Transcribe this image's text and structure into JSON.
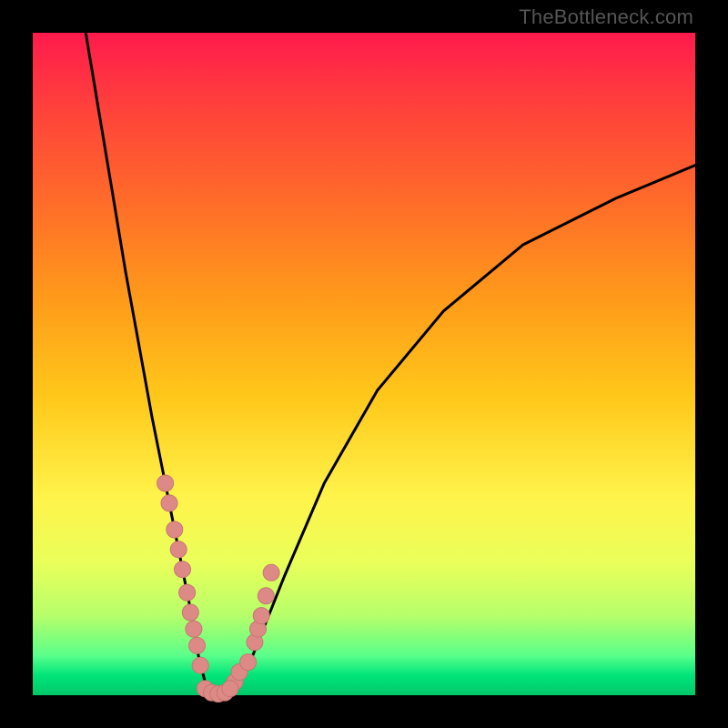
{
  "watermark": "TheBottleneck.com",
  "chart_data": {
    "type": "line",
    "title": "",
    "xlabel": "",
    "ylabel": "",
    "xlim": [
      0,
      100
    ],
    "ylim": [
      0,
      100
    ],
    "series": [
      {
        "name": "bottleneck-curve",
        "x": [
          8,
          10,
          12,
          14,
          16,
          18,
          20,
          21,
          22,
          23,
          24,
          24.5,
          25,
          25.5,
          26,
          27,
          28,
          29,
          30,
          32,
          34,
          38,
          44,
          52,
          62,
          74,
          88,
          100
        ],
        "values": [
          100,
          88,
          76,
          64,
          53,
          42,
          32,
          27,
          22,
          17,
          12,
          9,
          6,
          4,
          2,
          1,
          0,
          0,
          1,
          3,
          8,
          18,
          32,
          46,
          58,
          68,
          75,
          80
        ]
      }
    ],
    "markers_left": {
      "name": "cluster-left",
      "x": [
        20.0,
        20.6,
        21.4,
        22.0,
        22.6,
        23.3,
        23.8,
        24.3,
        24.8,
        25.3
      ],
      "values": [
        32,
        29,
        25,
        22,
        19,
        15.5,
        12.5,
        10,
        7.5,
        4.5
      ]
    },
    "markers_right": {
      "name": "cluster-right",
      "x": [
        30.5,
        31.2,
        32.5,
        33.5,
        34.0,
        34.5,
        35.2,
        36.0
      ],
      "values": [
        2,
        3.5,
        5,
        8,
        10,
        12,
        15,
        18.5
      ]
    },
    "markers_bottom": {
      "name": "cluster-bottom",
      "x": [
        26.0,
        27.0,
        28.0,
        29.0,
        29.8
      ],
      "values": [
        1.0,
        0.4,
        0.2,
        0.4,
        1.0
      ]
    },
    "colors": {
      "curve": "#000000",
      "marker_fill": "#dd8a87",
      "marker_stroke": "#c77673"
    }
  }
}
